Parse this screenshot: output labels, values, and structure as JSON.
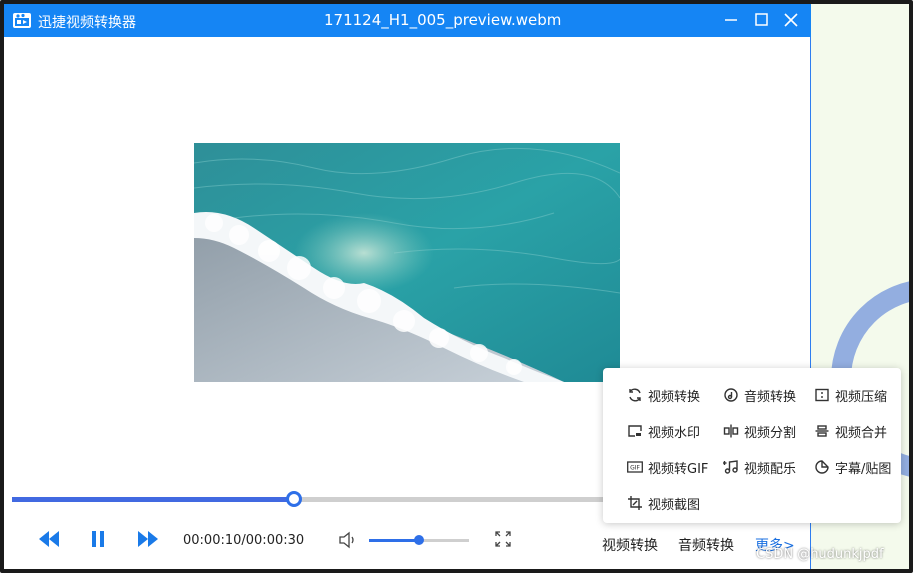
{
  "window": {
    "app_name": "迅捷视频转换器",
    "file_title": "171124_H1_005_preview.webm"
  },
  "player": {
    "time": "00:00:10/00:00:30",
    "progress_fraction": 0.47,
    "volume_fraction": 0.5
  },
  "bottom_links": {
    "video_convert": "视频转换",
    "audio_convert": "音频转换",
    "more": "更多>"
  },
  "popup": {
    "items": [
      {
        "label": "视频转换",
        "icon": "refresh-icon"
      },
      {
        "label": "音频转换",
        "icon": "music-disc-icon"
      },
      {
        "label": "视频压缩",
        "icon": "compress-icon"
      },
      {
        "label": "视频水印",
        "icon": "watermark-icon"
      },
      {
        "label": "视频分割",
        "icon": "split-icon"
      },
      {
        "label": "视频合并",
        "icon": "merge-icon"
      },
      {
        "label": "视频转GIF",
        "icon": "gif-icon"
      },
      {
        "label": "视频配乐",
        "icon": "music-note-icon"
      },
      {
        "label": "字幕/贴图",
        "icon": "sticker-icon"
      },
      {
        "label": "视频截图",
        "icon": "crop-icon"
      }
    ]
  },
  "watermark": "CSDN @hudunkjpdf",
  "colors": {
    "titlebar": "#1585f4",
    "accent": "#2e6fe8",
    "progress": "#4169e1"
  }
}
